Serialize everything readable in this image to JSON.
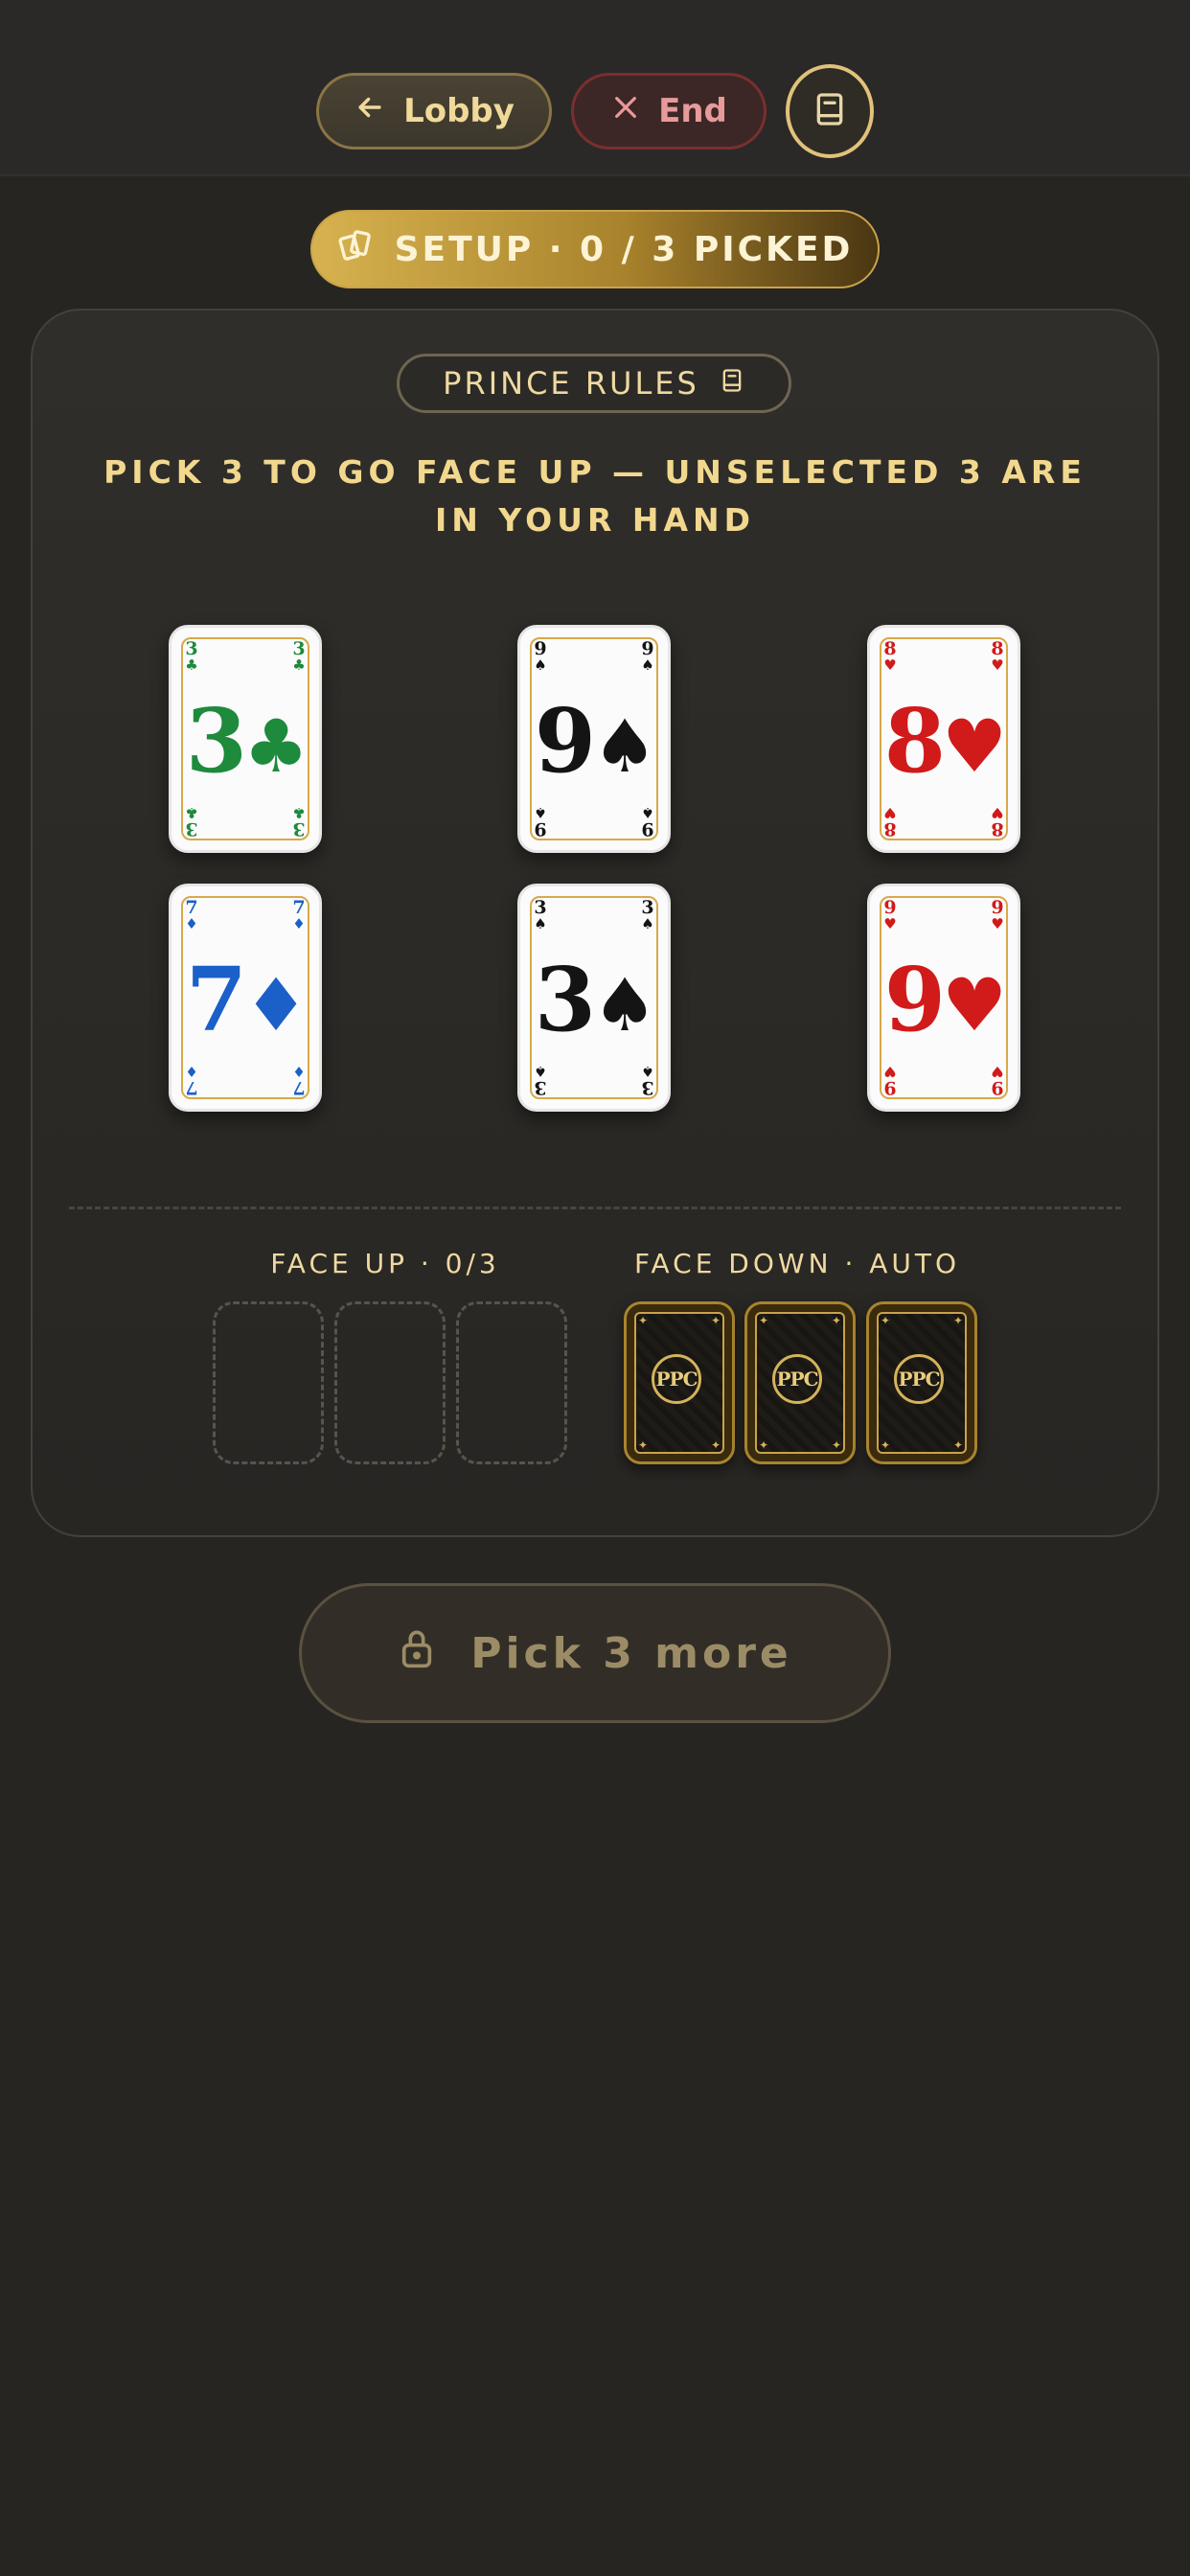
{
  "header": {
    "lobby_label": "Lobby",
    "end_label": "End"
  },
  "setup_status": "SETUP · 0 / 3 PICKED",
  "rules_label": "PRINCE RULES",
  "instructions": "PICK 3 TO GO FACE UP — UNSELECTED 3 ARE IN YOUR HAND",
  "hand": [
    {
      "rank": "3",
      "suit": "♣",
      "color": "#1e8a3c"
    },
    {
      "rank": "9",
      "suit": "♠",
      "color": "#141414"
    },
    {
      "rank": "8",
      "suit": "♥",
      "color": "#d11a1a"
    },
    {
      "rank": "7",
      "suit": "♦",
      "color": "#1b5fc9"
    },
    {
      "rank": "3",
      "suit": "♠",
      "color": "#141414"
    },
    {
      "rank": "9",
      "suit": "♥",
      "color": "#d11a1a"
    }
  ],
  "face_up": {
    "label": "FACE UP · 0/3",
    "picked": 0,
    "total": 3
  },
  "face_down": {
    "label": "FACE DOWN · AUTO",
    "card_logo": "PPC"
  },
  "action_button": "Pick 3 more",
  "colors": {
    "accent_gold": "#d7b24f",
    "background": "#272522",
    "danger": "#7a2f2f"
  }
}
